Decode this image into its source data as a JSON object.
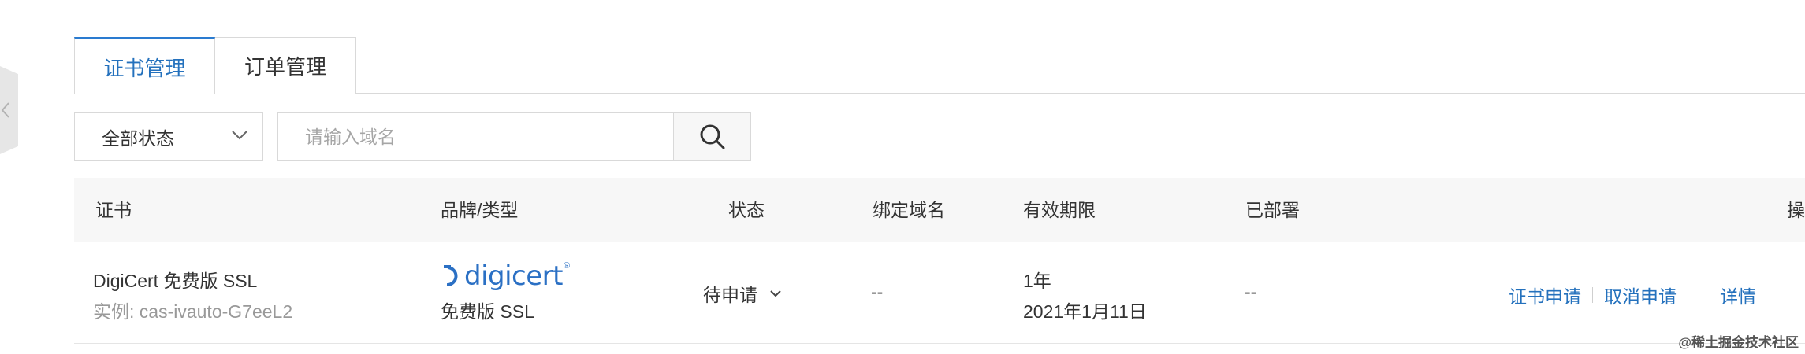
{
  "tabs": [
    {
      "label": "证书管理",
      "active": true
    },
    {
      "label": "订单管理",
      "active": false
    }
  ],
  "filters": {
    "status_selected": "全部状态",
    "search_placeholder": "请输入域名"
  },
  "table": {
    "columns": [
      "证书",
      "品牌/类型",
      "状态",
      "绑定域名",
      "有效期限",
      "已部署",
      "操"
    ],
    "rows": [
      {
        "name": "DigiCert 免费版 SSL",
        "instance": "实例: cas-ivauto-G7eeL2",
        "brand_logo_text": "digicert",
        "brand_logo_mark": "®",
        "brand_type": "免费版 SSL",
        "status": "待申请",
        "domain": "--",
        "validity_period": "1年",
        "validity_date": "2021年1月11日",
        "deployed": "--",
        "actions": [
          "证书申请",
          "取消申请",
          "详情"
        ]
      }
    ]
  },
  "colors": {
    "accent": "#2471bd",
    "brand_logo": "#2b70c4",
    "header_bg": "#f7f7f7",
    "border": "#d9d9d9",
    "muted_text": "#999999"
  },
  "icons": {
    "collapse": "chevron-left-icon",
    "select": "chevron-down-icon",
    "search": "search-icon",
    "status_dropdown": "chevron-down-icon"
  },
  "watermark": "@稀土掘金技术社区"
}
